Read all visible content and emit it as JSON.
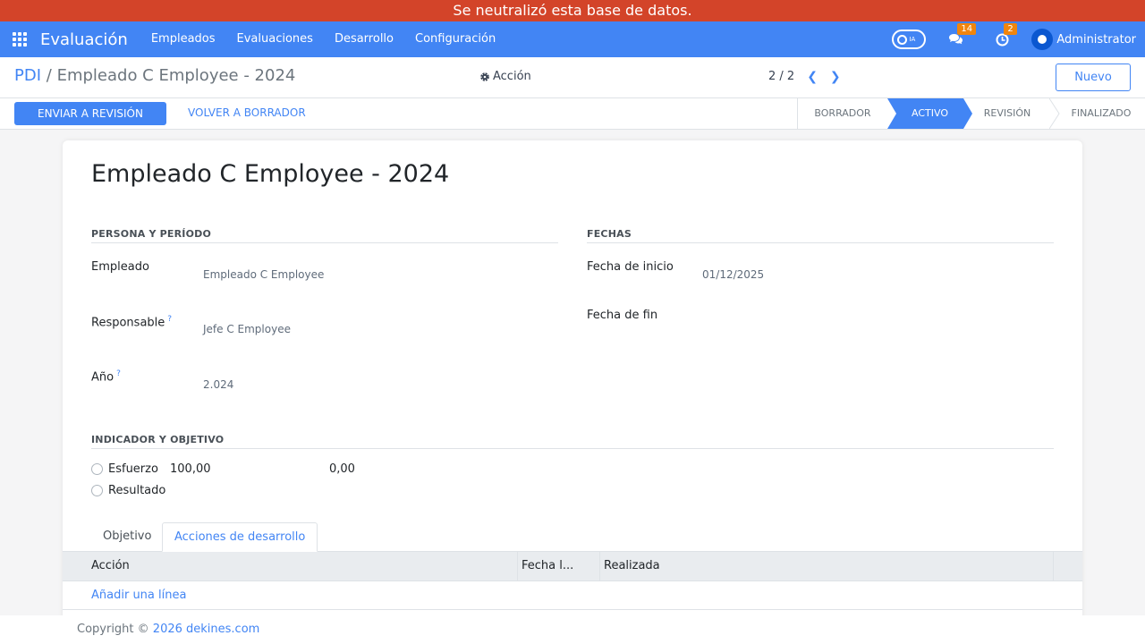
{
  "banner": {
    "text": "Se neutralizó esta base de datos."
  },
  "navbar": {
    "app_name": "Evaluación",
    "menu": [
      "Empleados",
      "Evaluaciones",
      "Desarrollo",
      "Configuración"
    ],
    "ai_label": "IA",
    "messages_count": "14",
    "activities_count": "2",
    "user_name": "Administrator"
  },
  "control_panel": {
    "breadcrumb_parent": "PDI",
    "breadcrumb_separator": "/",
    "breadcrumb_current": "Empleado C Employee - 2024",
    "action_label": "Acción",
    "pager_value": "2 / 2",
    "new_button": "Nuevo"
  },
  "statusbar": {
    "primary_button": "ENVIAR A REVISIÓN",
    "secondary_button": "VOLVER A BORRADOR",
    "stages": [
      "BORRADOR",
      "ACTIVO",
      "REVISIÓN",
      "FINALIZADO"
    ],
    "active_stage": "ACTIVO"
  },
  "form": {
    "title": "Empleado C Employee - 2024",
    "group_person": "PERSONA Y PERÍODO",
    "group_dates": "FECHAS",
    "fields": {
      "employee_label": "Empleado",
      "employee_value": "Empleado C Employee",
      "manager_label": "Responsable",
      "manager_value": "Jefe C Employee",
      "year_label": "Año",
      "year_value": "2.024",
      "start_label": "Fecha de inicio",
      "start_value": "01/12/2025",
      "end_label": "Fecha de fin",
      "end_value": "",
      "help_mark": "?"
    },
    "group_indicator": "INDICADOR Y OBJETIVO",
    "indicator": {
      "options": [
        "Esfuerzo",
        "Resultado"
      ],
      "value_a": "100,00",
      "value_b": "0,00"
    },
    "tabs": [
      "Objetivo",
      "Acciones de desarrollo"
    ],
    "active_tab": "Acciones de desarrollo",
    "table": {
      "columns": [
        "Acción",
        "Fecha l...",
        "Realizada"
      ],
      "add_line": "Añadir una línea"
    }
  },
  "footer": {
    "prefix": "Copyright ©",
    "link": "2026 dekines.com"
  },
  "colors": {
    "primary": "#4285f4",
    "banner": "#d34429",
    "badge": "#f0850d"
  }
}
